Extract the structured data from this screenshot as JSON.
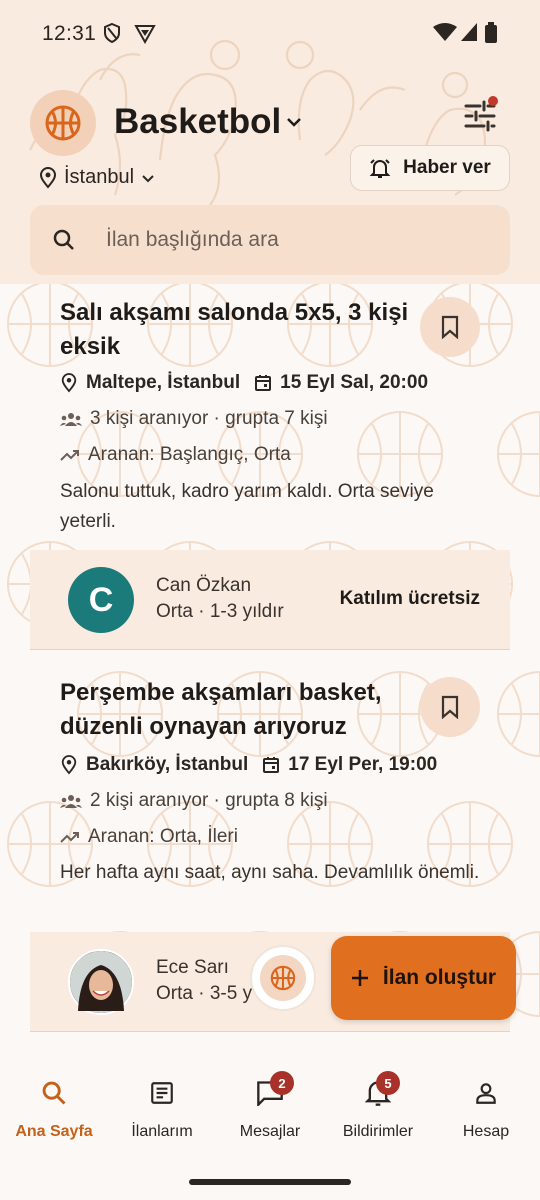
{
  "status_bar": {
    "time": "12:31"
  },
  "header": {
    "sport": "Basketbol",
    "location": "İstanbul",
    "notify_label": "Haber ver",
    "search_placeholder": "İlan başlığında ara"
  },
  "listings": [
    {
      "title": "Salı akşamı salonda 5x5, 3 kişi eksik",
      "place": "Maltepe, İstanbul",
      "datetime": "15 Eyl Sal, 20:00",
      "people": "3 kişi aranıyor · grupta 7 kişi",
      "level": "Aranan: Başlangıç, Orta",
      "description": "Salonu tuttuk, kadro yarım kaldı. Orta seviye yeterli.",
      "owner": {
        "initial": "C",
        "name": "Can Özkan",
        "level": "Orta · 1-3 yıldır",
        "fee": "Katılım ücretsiz",
        "avatar_color": "#1b7b7a"
      }
    },
    {
      "title": "Perşembe akşamları basket, düzenli oynayan arıyoruz",
      "place": "Bakırköy, İstanbul",
      "datetime": "17 Eyl Per, 19:00",
      "people": "2 kişi aranıyor · grupta 8 kişi",
      "level": "Aranan: Orta, İleri",
      "description": "Her hafta aynı saat, aynı saha. Devamlılık önemli.",
      "owner": {
        "name": "Ece Sarı",
        "level": "Orta · 3-5 y"
      }
    }
  ],
  "fab": {
    "label": "İlan oluştur"
  },
  "nav": {
    "items": [
      {
        "label": "Ana Sayfa",
        "icon": "search-icon",
        "active": true
      },
      {
        "label": "İlanlarım",
        "icon": "list-icon"
      },
      {
        "label": "Mesajlar",
        "icon": "chat-icon",
        "badge": "2"
      },
      {
        "label": "Bildirimler",
        "icon": "bell-icon",
        "badge": "5"
      },
      {
        "label": "Hesap",
        "icon": "person-icon"
      }
    ]
  },
  "colors": {
    "accent": "#e07020",
    "header_bg": "#f9ebe0",
    "badge": "#a8322a"
  }
}
